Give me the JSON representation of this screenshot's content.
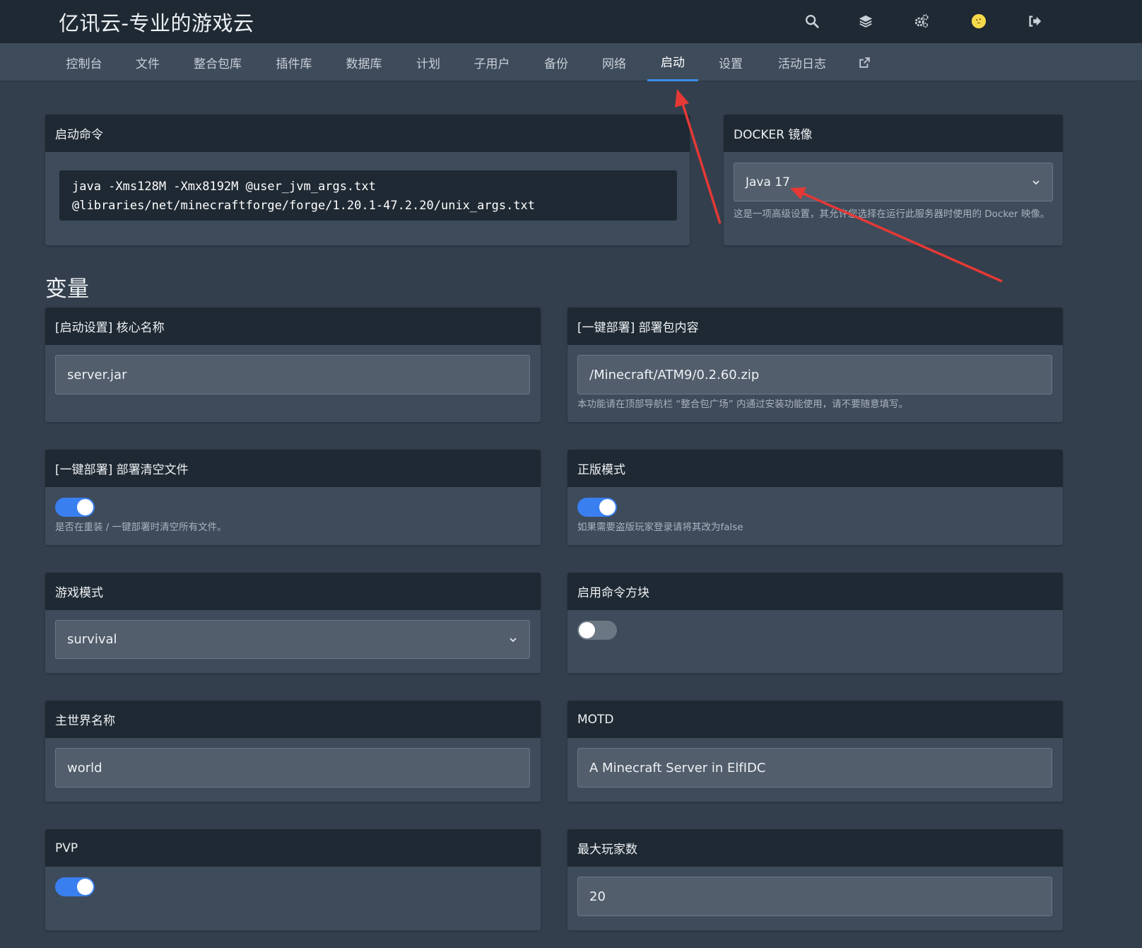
{
  "header": {
    "brand": "亿讯云-专业的游戏云",
    "icons": [
      "search-icon",
      "layers-icon",
      "settings-icon",
      "avatar-icon",
      "logout-icon"
    ]
  },
  "nav": {
    "tabs": [
      {
        "label": "控制台"
      },
      {
        "label": "文件"
      },
      {
        "label": "整合包库"
      },
      {
        "label": "插件库"
      },
      {
        "label": "数据库"
      },
      {
        "label": "计划"
      },
      {
        "label": "子用户"
      },
      {
        "label": "备份"
      },
      {
        "label": "网络"
      },
      {
        "label": "启动"
      },
      {
        "label": "设置"
      },
      {
        "label": "活动日志"
      }
    ],
    "active": "启动",
    "external_icon": "external-link-icon"
  },
  "startup": {
    "title": "启动命令",
    "command": "java -Xms128M -Xmx8192M @user_jvm_args.txt\n@libraries/net/minecraftforge/forge/1.20.1-47.2.20/unix_args.txt"
  },
  "docker": {
    "title": "DOCKER 镜像",
    "selected": "Java 17",
    "help": "这是一项高级设置，其允许您选择在运行此服务器时使用的 Docker 映像。"
  },
  "variables": {
    "title": "变量",
    "core_name": {
      "label": "[启动设置] 核心名称",
      "value": "server.jar"
    },
    "pack_content": {
      "label": "[一键部署] 部署包内容",
      "value": "/Minecraft/ATM9/0.2.60.zip",
      "help": "本功能请在顶部导航栏 “整合包广场” 内通过安装功能使用，请不要随意填写。"
    },
    "clear_files": {
      "label": "[一键部署] 部署清空文件",
      "on": true,
      "help": "是否在重装 / 一键部署时清空所有文件。"
    },
    "online_mode": {
      "label": "正版模式",
      "on": true,
      "help": "如果需要盗版玩家登录请将其改为false"
    },
    "game_mode": {
      "label": "游戏模式",
      "value": "survival"
    },
    "command_block": {
      "label": "启用命令方块",
      "on": false
    },
    "world_name": {
      "label": "主世界名称",
      "value": "world"
    },
    "motd": {
      "label": "MOTD",
      "value": "A Minecraft Server in ElfIDC"
    },
    "pvp": {
      "label": "PVP",
      "on": true
    },
    "max_players": {
      "label": "最大玩家数",
      "value": "20"
    }
  },
  "colors": {
    "background": "#333f4d",
    "topbar": "#1f2933",
    "accent": "#3a7ff0",
    "annotation_arrow": "#e53935"
  }
}
